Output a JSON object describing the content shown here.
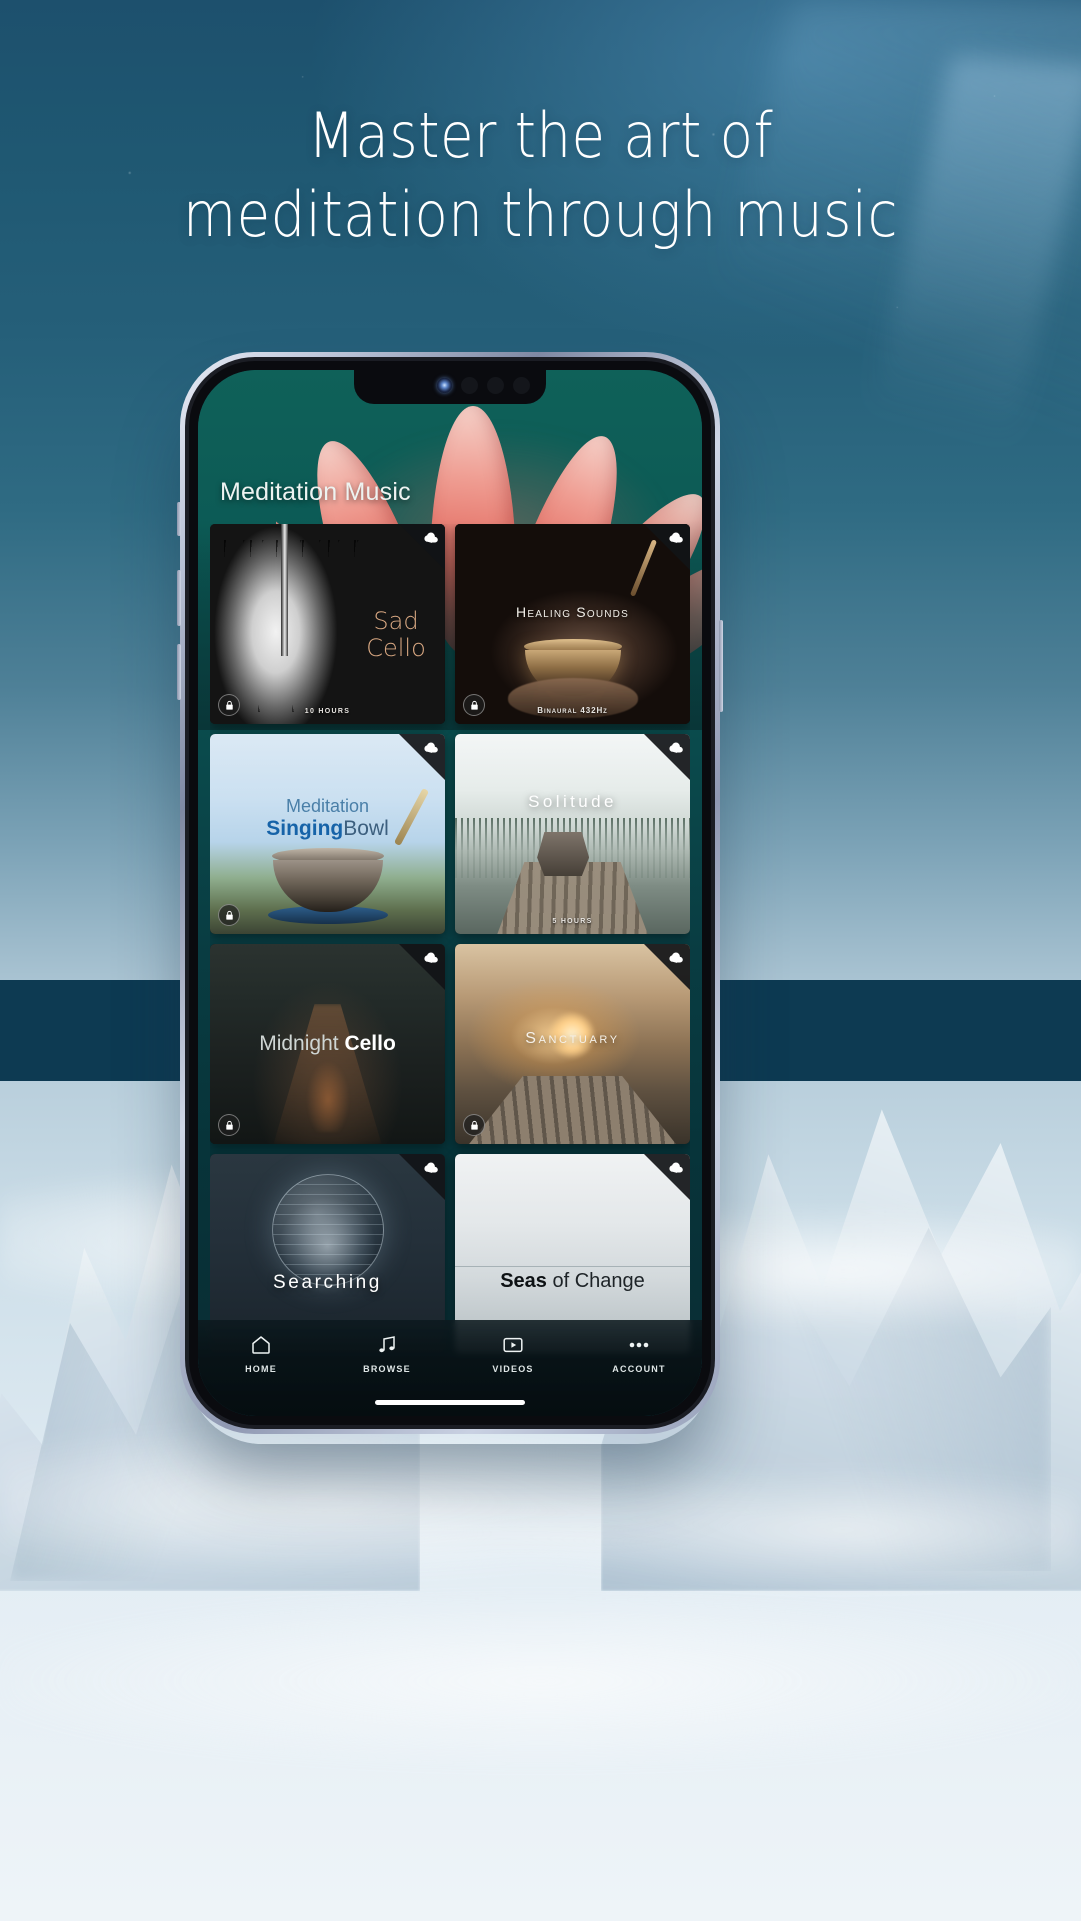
{
  "headline": {
    "line1": "Master the art of",
    "line2": "meditation through music"
  },
  "app": {
    "screen_title": "Meditation Music",
    "accent_teal": "#0a4a4c",
    "accent_tan": "#d9a882",
    "accent_blue": "#1663a8"
  },
  "cards": [
    {
      "id": "sad-cello",
      "title": "Sad Cello",
      "title_line1": "Sad",
      "title_line2": "Cello",
      "meta": "10 HOURS",
      "locked": true,
      "downloadable": true
    },
    {
      "id": "healing-sounds",
      "title": "Healing Sounds",
      "meta": "Binaural 432Hz",
      "locked": true,
      "downloadable": true
    },
    {
      "id": "meditation-singing-bowl",
      "title": "Meditation SingingBowl",
      "title_line1": "Meditation",
      "title_bold": "Singing",
      "title_rest": "Bowl",
      "meta": "",
      "locked": true,
      "downloadable": true
    },
    {
      "id": "solitude",
      "title": "Solitude",
      "meta": "5 HOURS",
      "locked": false,
      "downloadable": true
    },
    {
      "id": "midnight-cello",
      "title": "Midnight Cello",
      "title_light": "Midnight ",
      "title_bold": "Cello",
      "meta": "",
      "locked": true,
      "downloadable": true
    },
    {
      "id": "sanctuary",
      "title": "Sanctuary",
      "meta": "",
      "locked": true,
      "downloadable": true
    },
    {
      "id": "searching",
      "title": "Searching",
      "meta": "",
      "locked": false,
      "downloadable": true
    },
    {
      "id": "seas-of-change",
      "title": "Seas of Change",
      "title_bold": "Seas",
      "title_rest": " of Change",
      "meta": "",
      "locked": false,
      "downloadable": true
    }
  ],
  "nav": {
    "items": [
      {
        "icon": "home-icon",
        "label": "HOME"
      },
      {
        "icon": "music-note-icon",
        "label": "BROWSE"
      },
      {
        "icon": "video-icon",
        "label": "VIDEOS"
      },
      {
        "icon": "more-icon",
        "label": "ACCOUNT"
      }
    ]
  }
}
